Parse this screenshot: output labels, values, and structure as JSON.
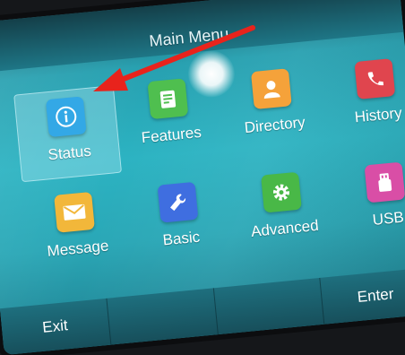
{
  "title": "Main Menu",
  "menu": {
    "items": [
      {
        "label": "Status",
        "color": "#33a8e6",
        "icon": "info-icon"
      },
      {
        "label": "Features",
        "color": "#4fbf4f",
        "icon": "features-icon"
      },
      {
        "label": "Directory",
        "color": "#f5a23a",
        "icon": "contact-icon"
      },
      {
        "label": "History",
        "color": "#e0454e",
        "icon": "phone-icon"
      },
      {
        "label": "Message",
        "color": "#f2b73a",
        "icon": "envelope-icon"
      },
      {
        "label": "Basic",
        "color": "#3f6ee0",
        "icon": "wrench-icon"
      },
      {
        "label": "Advanced",
        "color": "#49b847",
        "icon": "gear-icon"
      },
      {
        "label": "USB",
        "color": "#d94ea6",
        "icon": "usb-icon"
      }
    ],
    "selected": "Status"
  },
  "softkeys": [
    "Exit",
    "",
    "",
    "Enter"
  ],
  "annotation": {
    "color": "#e8231c",
    "icon": "arrow-icon"
  }
}
